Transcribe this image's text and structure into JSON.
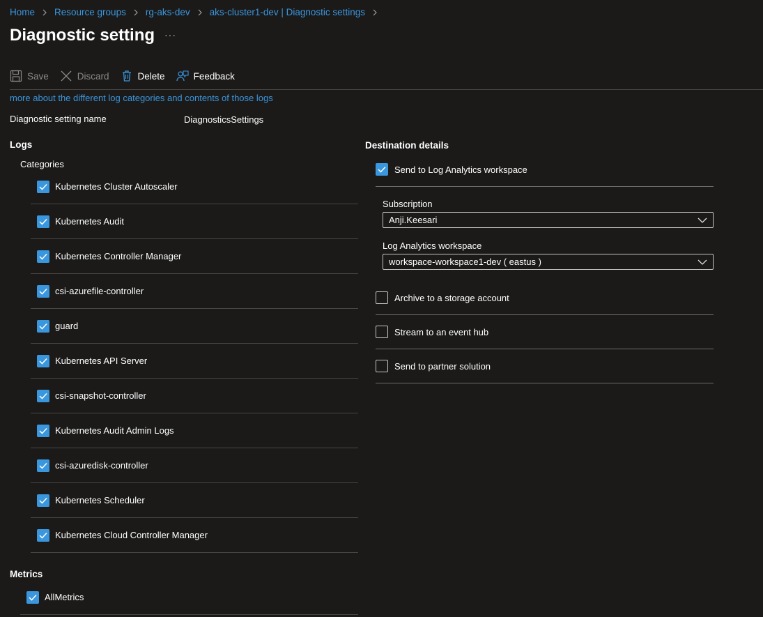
{
  "breadcrumb": [
    "Home",
    "Resource groups",
    "rg-aks-dev",
    "aks-cluster1-dev | Diagnostic settings"
  ],
  "page": {
    "title": "Diagnostic setting",
    "more": "···"
  },
  "toolbar": {
    "save": "Save",
    "discard": "Discard",
    "delete": "Delete",
    "feedback": "Feedback"
  },
  "info_link": "more about the different log categories and contents of those logs",
  "setting_name": {
    "label": "Diagnostic setting name",
    "value": "DiagnosticsSettings"
  },
  "logs": {
    "heading": "Logs",
    "categories_label": "Categories",
    "items": [
      {
        "label": "Kubernetes Cluster Autoscaler",
        "checked": true
      },
      {
        "label": "Kubernetes Audit",
        "checked": true
      },
      {
        "label": "Kubernetes Controller Manager",
        "checked": true
      },
      {
        "label": "csi-azurefile-controller",
        "checked": true
      },
      {
        "label": "guard",
        "checked": true
      },
      {
        "label": "Kubernetes API Server",
        "checked": true
      },
      {
        "label": "csi-snapshot-controller",
        "checked": true
      },
      {
        "label": "Kubernetes Audit Admin Logs",
        "checked": true
      },
      {
        "label": "csi-azuredisk-controller",
        "checked": true
      },
      {
        "label": "Kubernetes Scheduler",
        "checked": true
      },
      {
        "label": "Kubernetes Cloud Controller Manager",
        "checked": true
      }
    ]
  },
  "metrics": {
    "heading": "Metrics",
    "all_metrics": "AllMetrics",
    "checked": true
  },
  "destination": {
    "heading": "Destination details",
    "log_analytics": {
      "label": "Send to Log Analytics workspace",
      "checked": true
    },
    "subscription": {
      "label": "Subscription",
      "value": "Anji.Keesari"
    },
    "workspace": {
      "label": "Log Analytics workspace",
      "value": "workspace-workspace1-dev ( eastus )"
    },
    "archive": {
      "label": "Archive to a storage account",
      "checked": false
    },
    "event_hub": {
      "label": "Stream to an event hub",
      "checked": false
    },
    "partner": {
      "label": "Send to partner solution",
      "checked": false
    }
  },
  "colors": {
    "accent": "#3a96dd",
    "background": "#1b1a19",
    "divider": "#484644"
  }
}
